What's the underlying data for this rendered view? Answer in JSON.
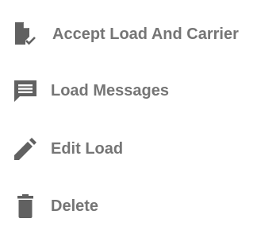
{
  "menu": {
    "icon_color": "#616161",
    "text_color": "#757575",
    "items": [
      {
        "label": "Accept Load And Carrier",
        "icon": "document-check-icon"
      },
      {
        "label": "Load Messages",
        "icon": "message-icon"
      },
      {
        "label": "Edit Load",
        "icon": "pencil-icon"
      },
      {
        "label": "Delete",
        "icon": "trash-icon"
      }
    ]
  }
}
